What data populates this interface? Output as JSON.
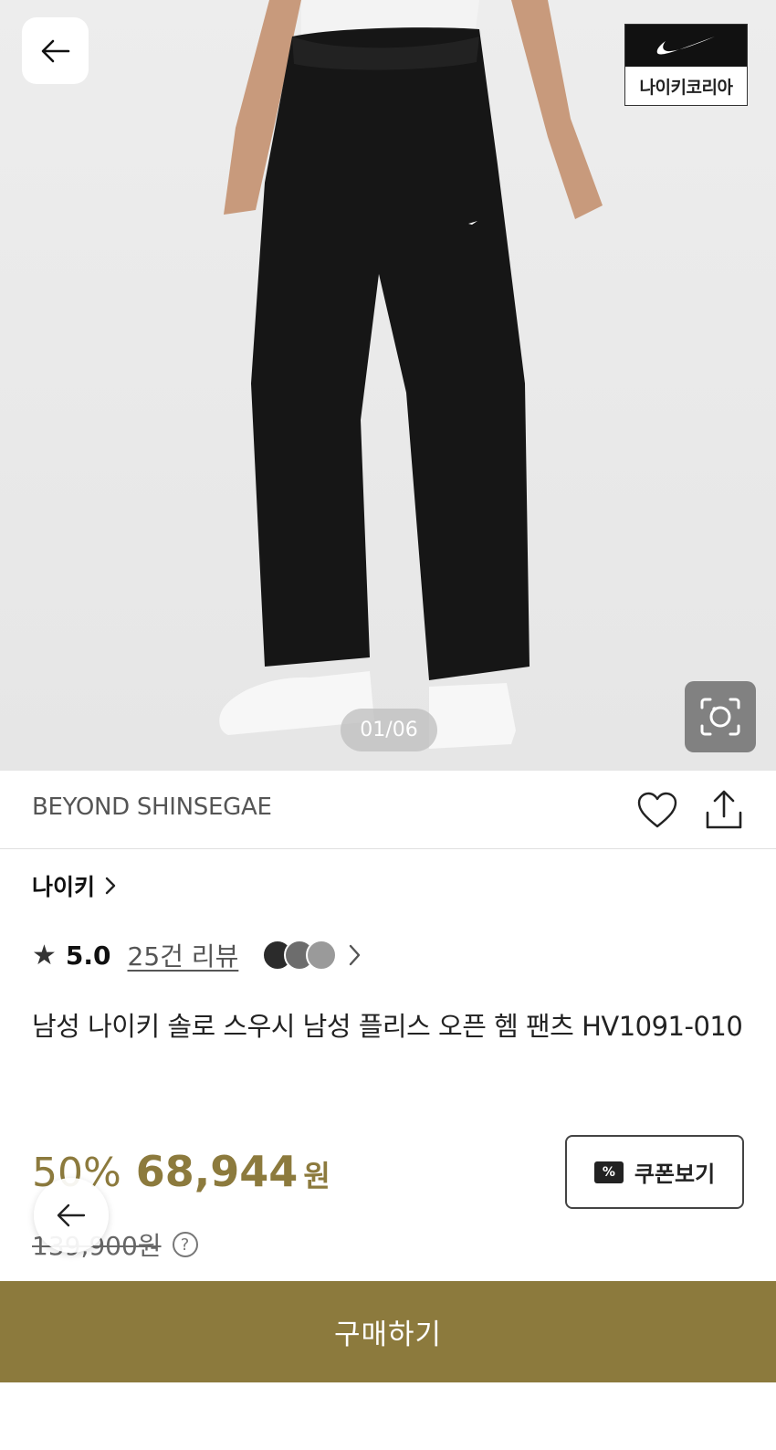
{
  "hero": {
    "counter": "01/06",
    "brand_badge_label": "나이키코리아"
  },
  "store": {
    "name": "BEYOND SHINSEGAE"
  },
  "product": {
    "brand": "나이키",
    "rating": "5.0",
    "reviews": "25건 리뷰",
    "title": "남성 나이키 솔로 스우시 남성 플리스 오픈 헴 팬츠 HV1091-010",
    "discount": "50%",
    "price": "68,944",
    "currency": "원",
    "original_price": "139,900원"
  },
  "actions": {
    "coupon_label": "쿠폰보기",
    "buy_label": "구매하기"
  },
  "icons": {
    "back": "arrow-left-icon",
    "lens": "visual-search-icon",
    "heart": "heart-icon",
    "share": "share-icon",
    "star": "star-icon",
    "coupon": "coupon-icon",
    "help": "question-icon"
  },
  "colors": {
    "accent": "#8c7a3d",
    "text": "#111111",
    "muted": "#555555"
  }
}
